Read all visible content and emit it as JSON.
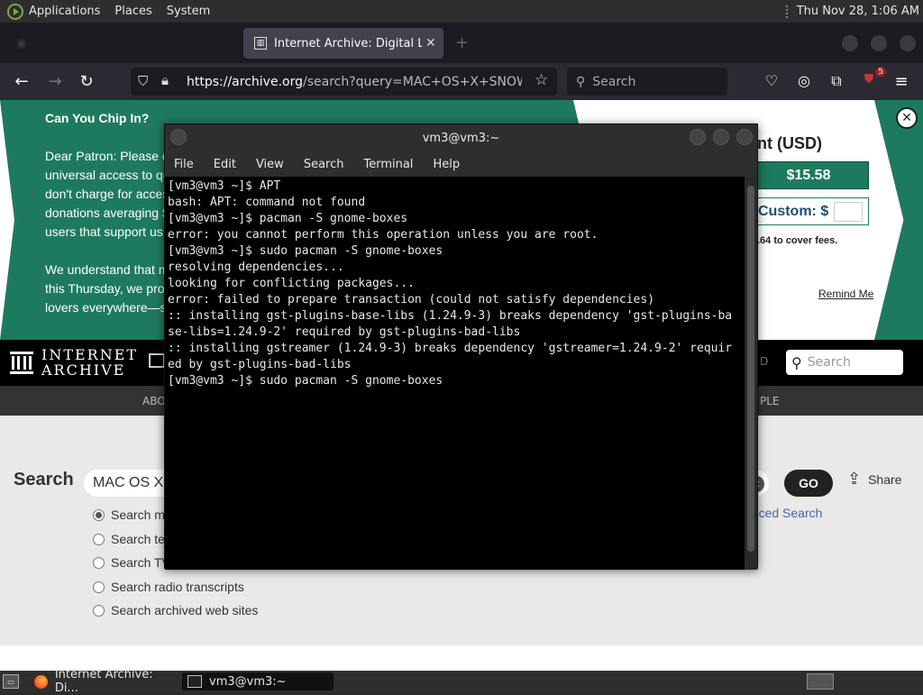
{
  "top_panel": {
    "menus": [
      "Applications",
      "Places",
      "System"
    ],
    "clock": "Thu Nov 28,  1:06 AM"
  },
  "browser": {
    "tab": {
      "title": "Internet Archive: Digital Lib",
      "close": "✕"
    },
    "url_host": "https://archive.org",
    "url_path": "/search?query=MAC+OS+X+SNOW+LEOP",
    "search_placeholder": "Search",
    "extension_badge": "5"
  },
  "donation": {
    "heading": "Can You Chip In?",
    "lines1": [
      "Dear Patron: Please d",
      "universal access to qu",
      "don't charge for acces",
      "donations averaging $",
      "users that support us"
    ],
    "lines2": [
      "We understand that m",
      "this Thursday, we pro",
      "lovers everywhere—s"
    ],
    "amount_title": "nt (USD)",
    "amount_button": "$15.58",
    "custom_label": "Custom: $",
    "fees_text": ".64 to cover fees.",
    "remind": "Remind Me"
  },
  "ia": {
    "logo_line1": "INTERNET",
    "logo_line2": "ARCHIVE",
    "header_search_placeholder": "Search",
    "header_dim": "D",
    "subnav_left": "ABO",
    "subnav_right": "PLE",
    "search_label": "Search",
    "search_value": "MAC OS X",
    "go": "GO",
    "share": "Share",
    "advanced": "anced Search",
    "radios": [
      {
        "label": "Search m",
        "checked": true
      },
      {
        "label": "Search te",
        "checked": false
      },
      {
        "label": "Search TV",
        "checked": false
      },
      {
        "label": "Search radio transcripts",
        "checked": false
      },
      {
        "label": "Search archived web sites",
        "checked": false
      }
    ]
  },
  "terminal": {
    "title": "vm3@vm3:~",
    "menus": [
      "File",
      "Edit",
      "View",
      "Search",
      "Terminal",
      "Help"
    ],
    "lines": [
      "[vm3@vm3 ~]$ APT",
      "bash: APT: command not found",
      "[vm3@vm3 ~]$ pacman -S gnome-boxes",
      "error: you cannot perform this operation unless you are root.",
      "[vm3@vm3 ~]$ sudo pacman -S gnome-boxes",
      "resolving dependencies...",
      "looking for conflicting packages...",
      "error: failed to prepare transaction (could not satisfy dependencies)",
      ":: installing gst-plugins-base-libs (1.24.9-3) breaks dependency 'gst-plugins-ba",
      "se-libs=1.24.9-2' required by gst-plugins-bad-libs",
      ":: installing gstreamer (1.24.9-3) breaks dependency 'gstreamer=1.24.9-2' requir",
      "ed by gst-plugins-bad-libs",
      "[vm3@vm3 ~]$ sudo pacman -S gnome-boxes"
    ]
  },
  "taskbar": {
    "items": [
      "Internet Archive: Di...",
      "vm3@vm3:~"
    ]
  }
}
